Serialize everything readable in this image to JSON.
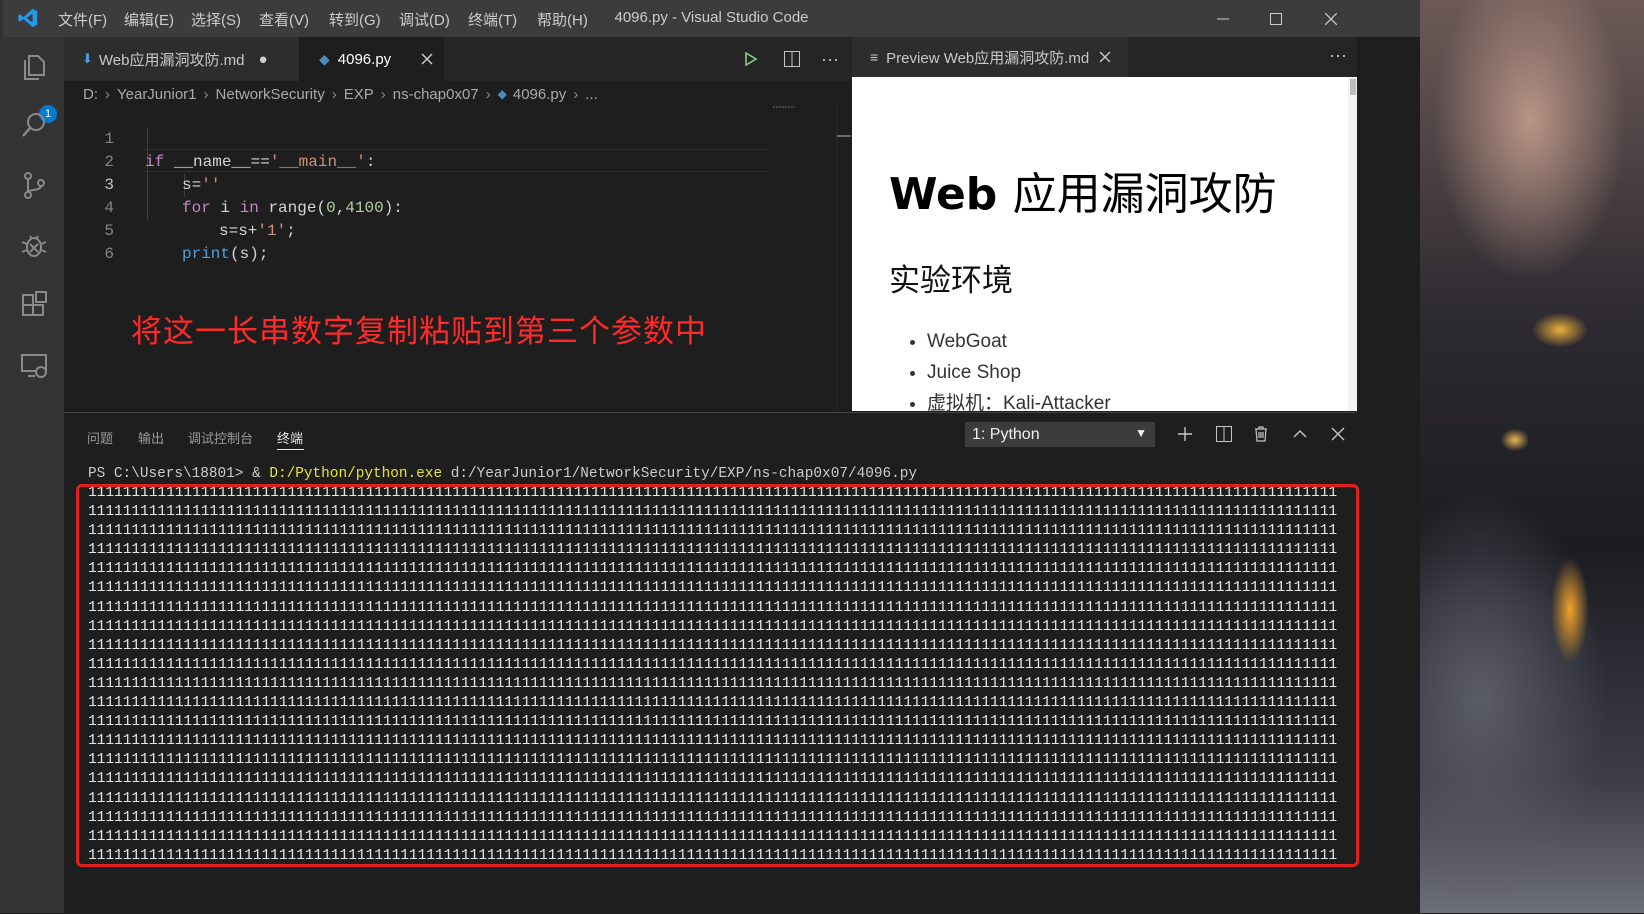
{
  "titlebar": {
    "menus": [
      "文件(F)",
      "编辑(E)",
      "选择(S)",
      "查看(V)",
      "转到(G)",
      "调试(D)",
      "终端(T)",
      "帮助(H)"
    ],
    "title": "4096.py - Visual Studio Code"
  },
  "activitybar": {
    "explorer_badge": "1",
    "icons": [
      "files-icon",
      "search-icon",
      "source-control-icon",
      "debug-icon",
      "extensions-icon",
      "remote-explorer-icon"
    ]
  },
  "editor": {
    "tabs": [
      {
        "label": "Web应用漏洞攻防.md",
        "state": "modified"
      },
      {
        "label": "4096.py",
        "state": "active"
      }
    ],
    "breadcrumb": [
      "D:",
      "YearJunior1",
      "NetworkSecurity",
      "EXP",
      "ns-chap0x07",
      "4096.py",
      "..."
    ],
    "line_numbers": [
      "1",
      "2",
      "3",
      "4",
      "5",
      "6"
    ],
    "code": {
      "l1_kw": "if",
      "l1_name": "__name__",
      "l1_eq": "==",
      "l1_str": "'__main__'",
      "l1_colon": ":",
      "l2_var": "s",
      "l2_eq": "=",
      "l2_str": "''",
      "l3_for": "for",
      "l3_i": "i",
      "l3_in": "in",
      "l3_range": "range",
      "l3_open": "(",
      "l3_n0": "0",
      "l3_comma": ",",
      "l3_n1": "4100",
      "l3_close": "):",
      "l4_a": "s=s+",
      "l4_str": "'1'",
      "l4_semi": ";",
      "l5_print": "print",
      "l5_rest": "(s);"
    },
    "annotation": "将这一长串数字复制粘贴到第三个参数中"
  },
  "preview": {
    "tab_label": "Preview Web应用漏洞攻防.md",
    "h1_latin": "Web",
    "h1_cjk": "应用漏洞攻防",
    "h2": "实验环境",
    "items": [
      "WebGoat",
      "Juice Shop",
      "虚拟机：Kali-Attacker"
    ]
  },
  "panel": {
    "tabs": [
      "问题",
      "输出",
      "调试控制台",
      "终端"
    ],
    "active_tab": "终端",
    "terminal_selector": "1: Python",
    "prompt": "PS C:\\Users\\18801> & ",
    "exe_path": "D:/Python/python.exe",
    "script_arg": " d:/YearJunior1/NetworkSecurity/EXP/ns-chap0x07/4096.py",
    "output_char": "1",
    "output_count": 4100
  },
  "colors": {
    "accent": "#007acc",
    "annotation": "#ff2a2a",
    "highlight_box": "#e0201f",
    "terminal_path": "#e8e33b"
  }
}
